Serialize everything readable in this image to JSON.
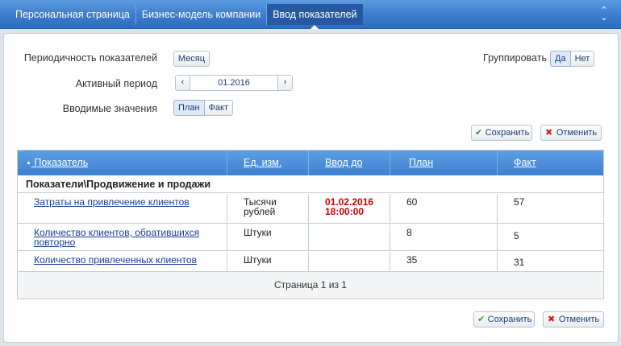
{
  "tabs": [
    {
      "label": "Персональная страница"
    },
    {
      "label": "Бизнес-модель компании"
    },
    {
      "label": "Ввод показателей"
    }
  ],
  "filters": {
    "periodicity_label": "Периодичность показателей",
    "periodicity_value": "Месяц",
    "active_period_label": "Активный период",
    "active_period_value": "01.2016",
    "values_label": "Вводимые значения",
    "values_options": [
      "План",
      "Факт"
    ],
    "values_selected": "План",
    "group_label": "Группировать",
    "group_options": [
      "Да",
      "Нет"
    ],
    "group_selected": "Да"
  },
  "actions": {
    "save": "Сохранить",
    "cancel": "Отменить"
  },
  "table": {
    "columns": [
      "Показатель",
      "Ед. изм.",
      "Ввод до",
      "План",
      "Факт"
    ],
    "sort_column": "Показатель",
    "group_title": "Показатели\\Продвижение и продажи",
    "rows": [
      {
        "name": "Затраты на привлечение клиентов",
        "unit": "Тысячи рублей",
        "deadline": "01.02.2016 18:00:00",
        "plan": "60",
        "fact": "57"
      },
      {
        "name": "Количество клиентов, обратившихся повторно",
        "unit": "Штуки",
        "deadline": "",
        "plan": "8",
        "fact": "5"
      },
      {
        "name": "Количество привлеченных клиентов",
        "unit": "Штуки",
        "deadline": "",
        "plan": "35",
        "fact": "31"
      }
    ],
    "pagination": "Страница 1 из 1"
  },
  "colors": {
    "accent": "#3b7ccd",
    "deadline": "#cc0000",
    "link": "#1a3c9a"
  }
}
